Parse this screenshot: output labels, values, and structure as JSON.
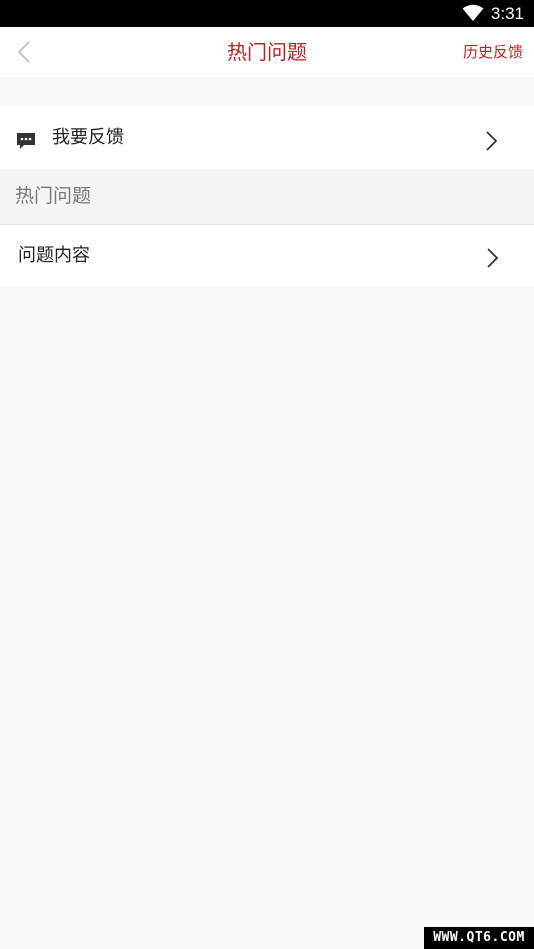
{
  "status_bar": {
    "time": "3:31",
    "wifi_icon": "wifi-icon"
  },
  "nav": {
    "back_icon": "chevron-left-icon",
    "title": "热门问题",
    "right_action": "历史反馈"
  },
  "feedback": {
    "icon": "message-icon",
    "label": "我要反馈",
    "chevron_icon": "chevron-right-icon"
  },
  "section": {
    "header": "热门问题"
  },
  "questions": [
    {
      "label": "问题内容",
      "chevron_icon": "chevron-right-icon"
    }
  ],
  "watermark": {
    "text": "WWW.QT6.COM"
  },
  "colors": {
    "accent": "#c0211f",
    "background": "#f8f8f8",
    "surface": "#ffffff",
    "status_bar": "#000000"
  }
}
